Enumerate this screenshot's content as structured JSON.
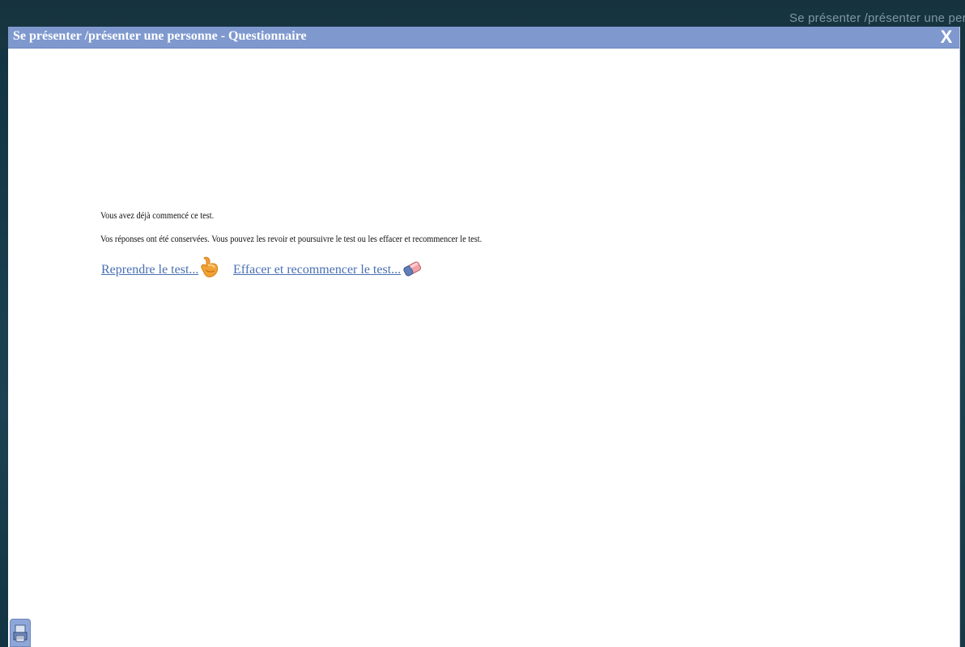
{
  "background": {
    "window_title": "Se présenter /présenter une personne"
  },
  "dialog": {
    "title": "Se présenter /présenter une personne - Questionnaire",
    "close_label": "X",
    "message_line1": "Vous avez déjà commencé ce test.",
    "message_line2": "Vos réponses ont été conservées. Vous pouvez les revoir et poursuivre le test ou les effacer et recommencer le test.",
    "resume_link": "Reprendre le test...",
    "reset_link": "Effacer et recommencer le test...",
    "resume_icon": "hand-pointer-icon",
    "reset_icon": "eraser-icon",
    "print_icon": "printer-icon"
  },
  "colors": {
    "titlebar": "#7f99cf",
    "link": "#4a6fb3",
    "background": "#1f4552"
  }
}
